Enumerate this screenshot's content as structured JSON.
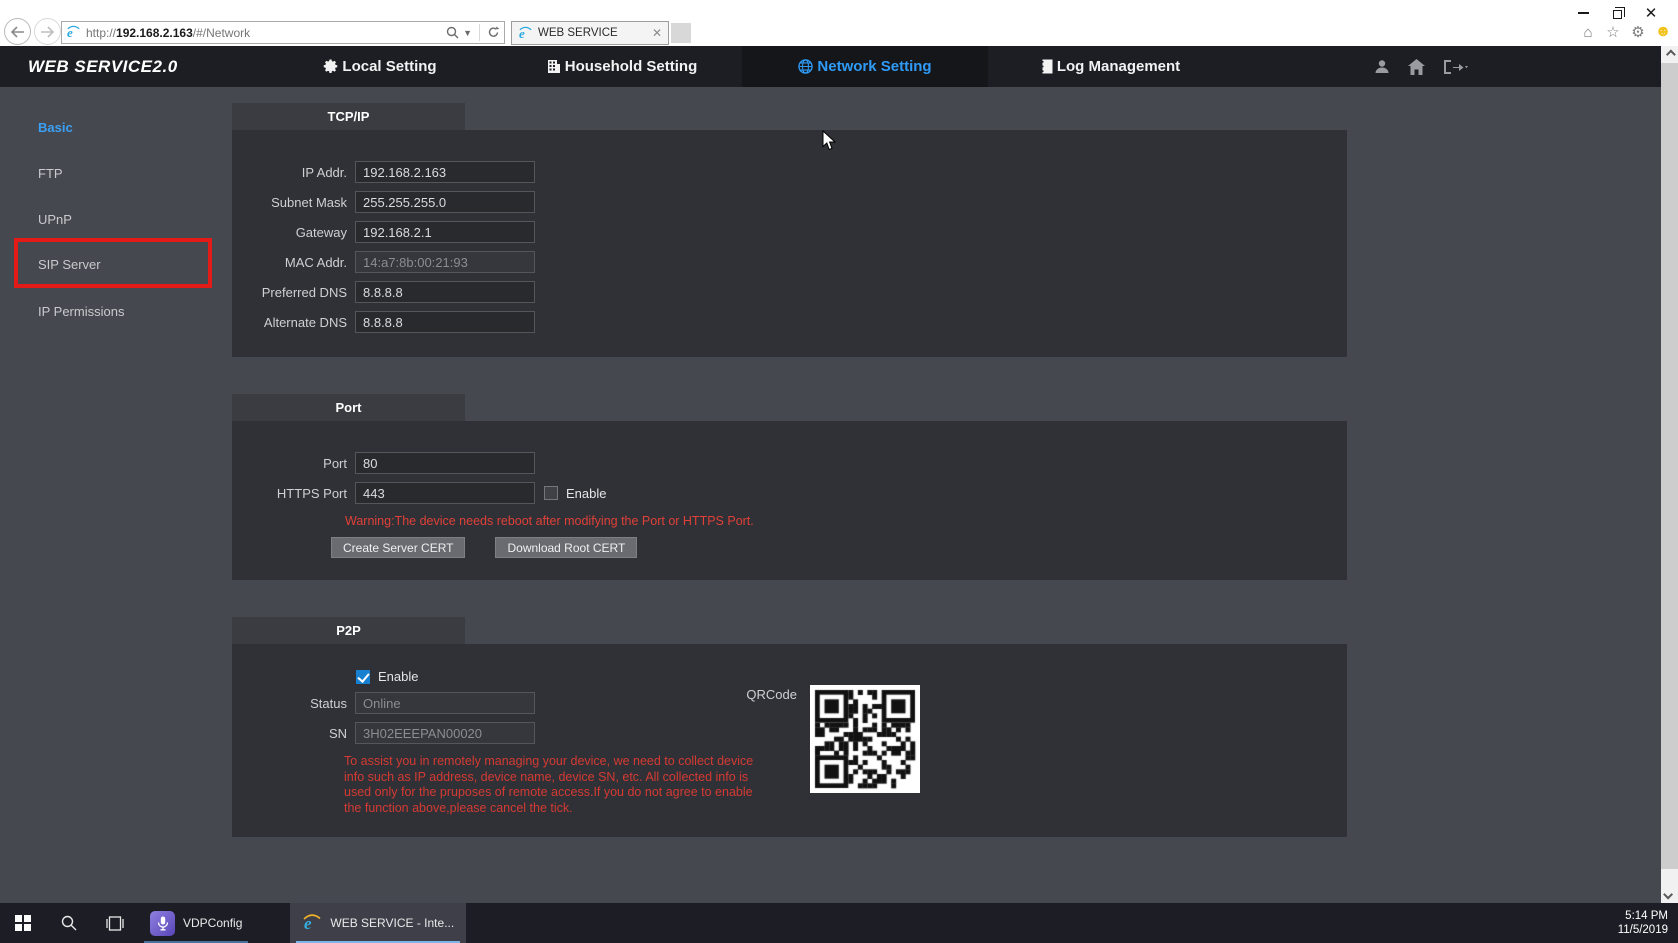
{
  "browser": {
    "url_scheme": "http://",
    "url_host": "192.168.2.163",
    "url_path": "/#/Network",
    "tab_title": "WEB SERVICE"
  },
  "header": {
    "logo": "WEB SERVICE2.0",
    "nav": [
      {
        "label": "Local Setting",
        "icon": "gear-icon",
        "active": false
      },
      {
        "label": "Household Setting",
        "icon": "building-icon",
        "active": false
      },
      {
        "label": "Network Setting",
        "icon": "globe-icon",
        "active": true
      },
      {
        "label": "Log Management",
        "icon": "log-icon",
        "active": false
      }
    ]
  },
  "sidebar": {
    "items": [
      {
        "label": "Basic",
        "active": true,
        "highlighted": false
      },
      {
        "label": "FTP",
        "active": false,
        "highlighted": false
      },
      {
        "label": "UPnP",
        "active": false,
        "highlighted": false
      },
      {
        "label": "SIP Server",
        "active": false,
        "highlighted": true
      },
      {
        "label": "IP Permissions",
        "active": false,
        "highlighted": false
      }
    ]
  },
  "tcpip": {
    "title": "TCP/IP",
    "fields": [
      {
        "label": "IP Addr.",
        "value": "192.168.2.163",
        "disabled": false
      },
      {
        "label": "Subnet Mask",
        "value": "255.255.255.0",
        "disabled": false
      },
      {
        "label": "Gateway",
        "value": "192.168.2.1",
        "disabled": false
      },
      {
        "label": "MAC Addr.",
        "value": "14:a7:8b:00:21:93",
        "disabled": true
      },
      {
        "label": "Preferred DNS",
        "value": "8.8.8.8",
        "disabled": false
      },
      {
        "label": "Alternate DNS",
        "value": "8.8.8.8",
        "disabled": false
      }
    ]
  },
  "port": {
    "title": "Port",
    "port_label": "Port",
    "port_value": "80",
    "https_label": "HTTPS Port",
    "https_value": "443",
    "enable_label": "Enable",
    "https_enabled": false,
    "warning": "Warning:The device needs reboot after modifying the Port or HTTPS Port.",
    "buttons": [
      {
        "label": "Create Server CERT"
      },
      {
        "label": "Download Root CERT"
      }
    ]
  },
  "p2p": {
    "title": "P2P",
    "enable_label": "Enable",
    "enabled": true,
    "status_label": "Status",
    "status_value": "Online",
    "sn_label": "SN",
    "sn_value": "3H02EEEPAN00020",
    "notice": "To assist you in remotely managing your device, we need to collect device info such as IP address, device name, device SN, etc. All collected info is used only for the pruposes of remote access.If you do not agree to enable the function above,please cancel the tick.",
    "qrcode_label": "QRCode"
  },
  "taskbar": {
    "apps": [
      {
        "label": "VDPConfig",
        "icon": "vdpconfig-icon",
        "active": false
      },
      {
        "label": "WEB SERVICE - Inte...",
        "icon": "internet-explorer-icon",
        "active": true
      }
    ],
    "time": "5:14 PM",
    "date": "11/5/2019"
  },
  "icons": {
    "search": "magnifier glyph",
    "refresh": "circular arrow",
    "home": "house outline",
    "favorites": "star outline",
    "settings": "gear",
    "feedback": "yellow smiley",
    "user": "person silhouette",
    "logout": "door with arrow"
  },
  "colors": {
    "accent_blue": "#2f9bf7",
    "sidebar_active_blue": "#3aa0f5",
    "annotation_red": "#e31b18",
    "warning_red": "#e04038",
    "header_bg": "#1c1e23",
    "page_bg": "#46484f",
    "panel_bg": "#2f3136",
    "taskbar_bg": "#1d1e25",
    "checkbox_checked_blue": "#1780d0"
  }
}
